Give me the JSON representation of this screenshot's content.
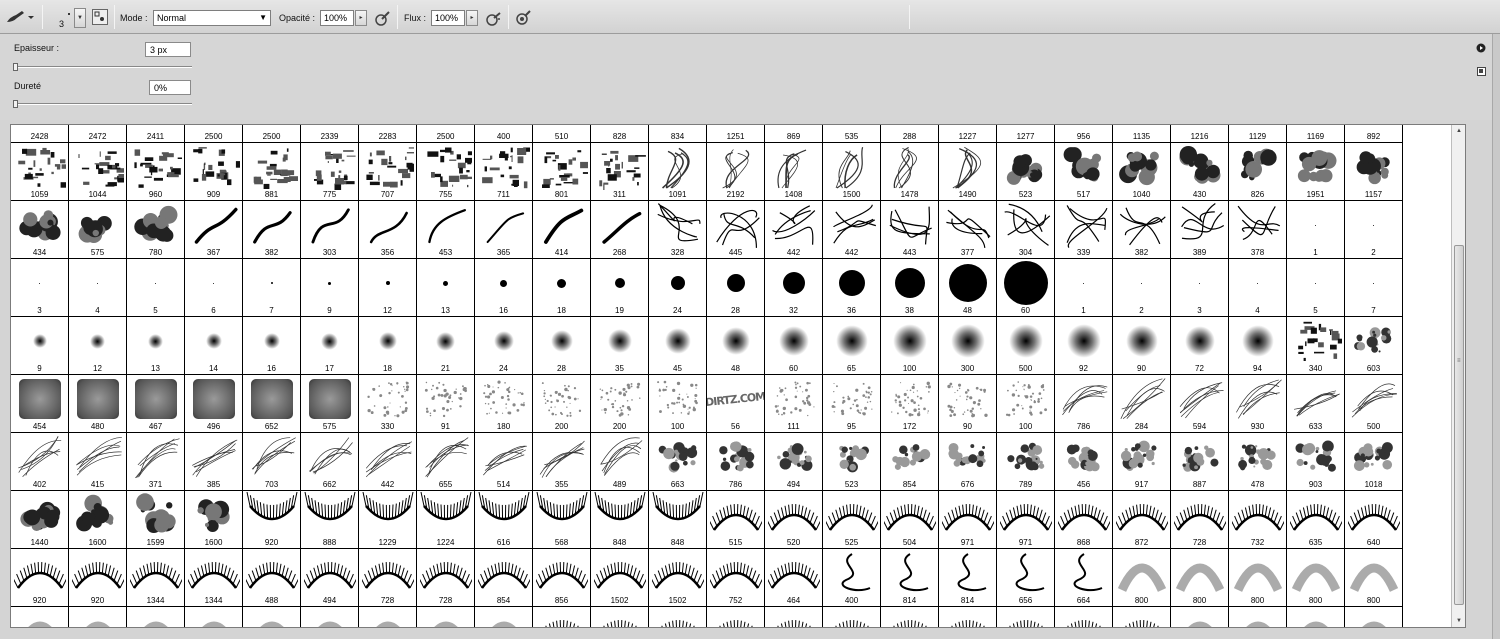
{
  "toolbar": {
    "brush_size": "3",
    "mode_label": "Mode :",
    "mode_value": "Normal",
    "opacity_label": "Opacité :",
    "opacity_value": "100%",
    "flow_label": "Flux :",
    "flow_value": "100%",
    "icons": [
      "brush-tool-icon",
      "brush-preset-picker-icon",
      "brush-panel-toggle-icon",
      "airbrush-icon",
      "tablet-pressure-opacity-icon",
      "tablet-pressure-size-icon"
    ]
  },
  "settings": {
    "thickness_label": "Epaisseur :",
    "thickness_value": "3 px",
    "thickness_level": 0.0,
    "hardness_label": "Dureté",
    "hardness_value": "0%",
    "hardness_level": 0.0
  },
  "brushes": {
    "top_row": [
      "2428",
      "2472",
      "2411",
      "2500",
      "2500",
      "2339",
      "2283",
      "2500",
      "400",
      "510",
      "828",
      "834",
      "1251",
      "869",
      "535",
      "288",
      "1227",
      "1277",
      "956",
      "1135",
      "1216",
      "1129",
      "1169",
      "892"
    ],
    "rows": [
      {
        "kind": "grunge",
        "labels": [
          "1059",
          "1044",
          "960",
          "909",
          "881",
          "775",
          "707",
          "755",
          "711",
          "801",
          "311",
          "1091",
          "2192",
          "1408",
          "1500",
          "1478",
          "1490",
          "523",
          "517",
          "1040",
          "430",
          "826",
          "1951",
          "1157"
        ]
      },
      {
        "kind": "strokes",
        "labels": [
          "434",
          "575",
          "780",
          "367",
          "382",
          "303",
          "356",
          "453",
          "365",
          "414",
          "268",
          "328",
          "445",
          "442",
          "442",
          "443",
          "377",
          "304",
          "339",
          "382",
          "389",
          "378",
          "1",
          "2"
        ]
      },
      {
        "kind": "hard",
        "labels": [
          "3",
          "4",
          "5",
          "6",
          "7",
          "9",
          "12",
          "13",
          "16",
          "18",
          "19",
          "24",
          "28",
          "32",
          "36",
          "38",
          "48",
          "60",
          "1",
          "2",
          "3",
          "4",
          "5",
          "7"
        ]
      },
      {
        "kind": "soft",
        "labels": [
          "9",
          "12",
          "13",
          "14",
          "16",
          "17",
          "18",
          "21",
          "24",
          "28",
          "35",
          "45",
          "48",
          "60",
          "65",
          "100",
          "300",
          "500",
          "92",
          "90",
          "72",
          "94",
          "340",
          "603"
        ]
      },
      {
        "kind": "texture",
        "labels": [
          "454",
          "480",
          "467",
          "496",
          "652",
          "575",
          "330",
          "91",
          "180",
          "200",
          "200",
          "100",
          "56",
          "111",
          "95",
          "172",
          "90",
          "100",
          "786",
          "284",
          "594",
          "930",
          "633",
          "500"
        ]
      },
      {
        "kind": "hair",
        "labels": [
          "402",
          "415",
          "371",
          "385",
          "703",
          "662",
          "442",
          "655",
          "514",
          "355",
          "489",
          "663",
          "786",
          "494",
          "523",
          "854",
          "676",
          "789",
          "456",
          "917",
          "887",
          "478",
          "903",
          "1018"
        ]
      },
      {
        "kind": "lashes",
        "labels": [
          "1440",
          "1600",
          "1599",
          "1600",
          "920",
          "888",
          "1229",
          "1224",
          "616",
          "568",
          "848",
          "848",
          "515",
          "520",
          "525",
          "504",
          "971",
          "971",
          "868",
          "872",
          "728",
          "732",
          "635",
          "640"
        ]
      },
      {
        "kind": "lashes2",
        "labels": [
          "920",
          "920",
          "1344",
          "1344",
          "488",
          "494",
          "728",
          "728",
          "854",
          "856",
          "1502",
          "1502",
          "752",
          "464",
          "400",
          "814",
          "814",
          "656",
          "664",
          "800",
          "800",
          "800",
          "800",
          "800"
        ]
      }
    ],
    "stamp_text": "DIRTZ.COM",
    "stamp_column": 12,
    "stamp_row": 4
  }
}
